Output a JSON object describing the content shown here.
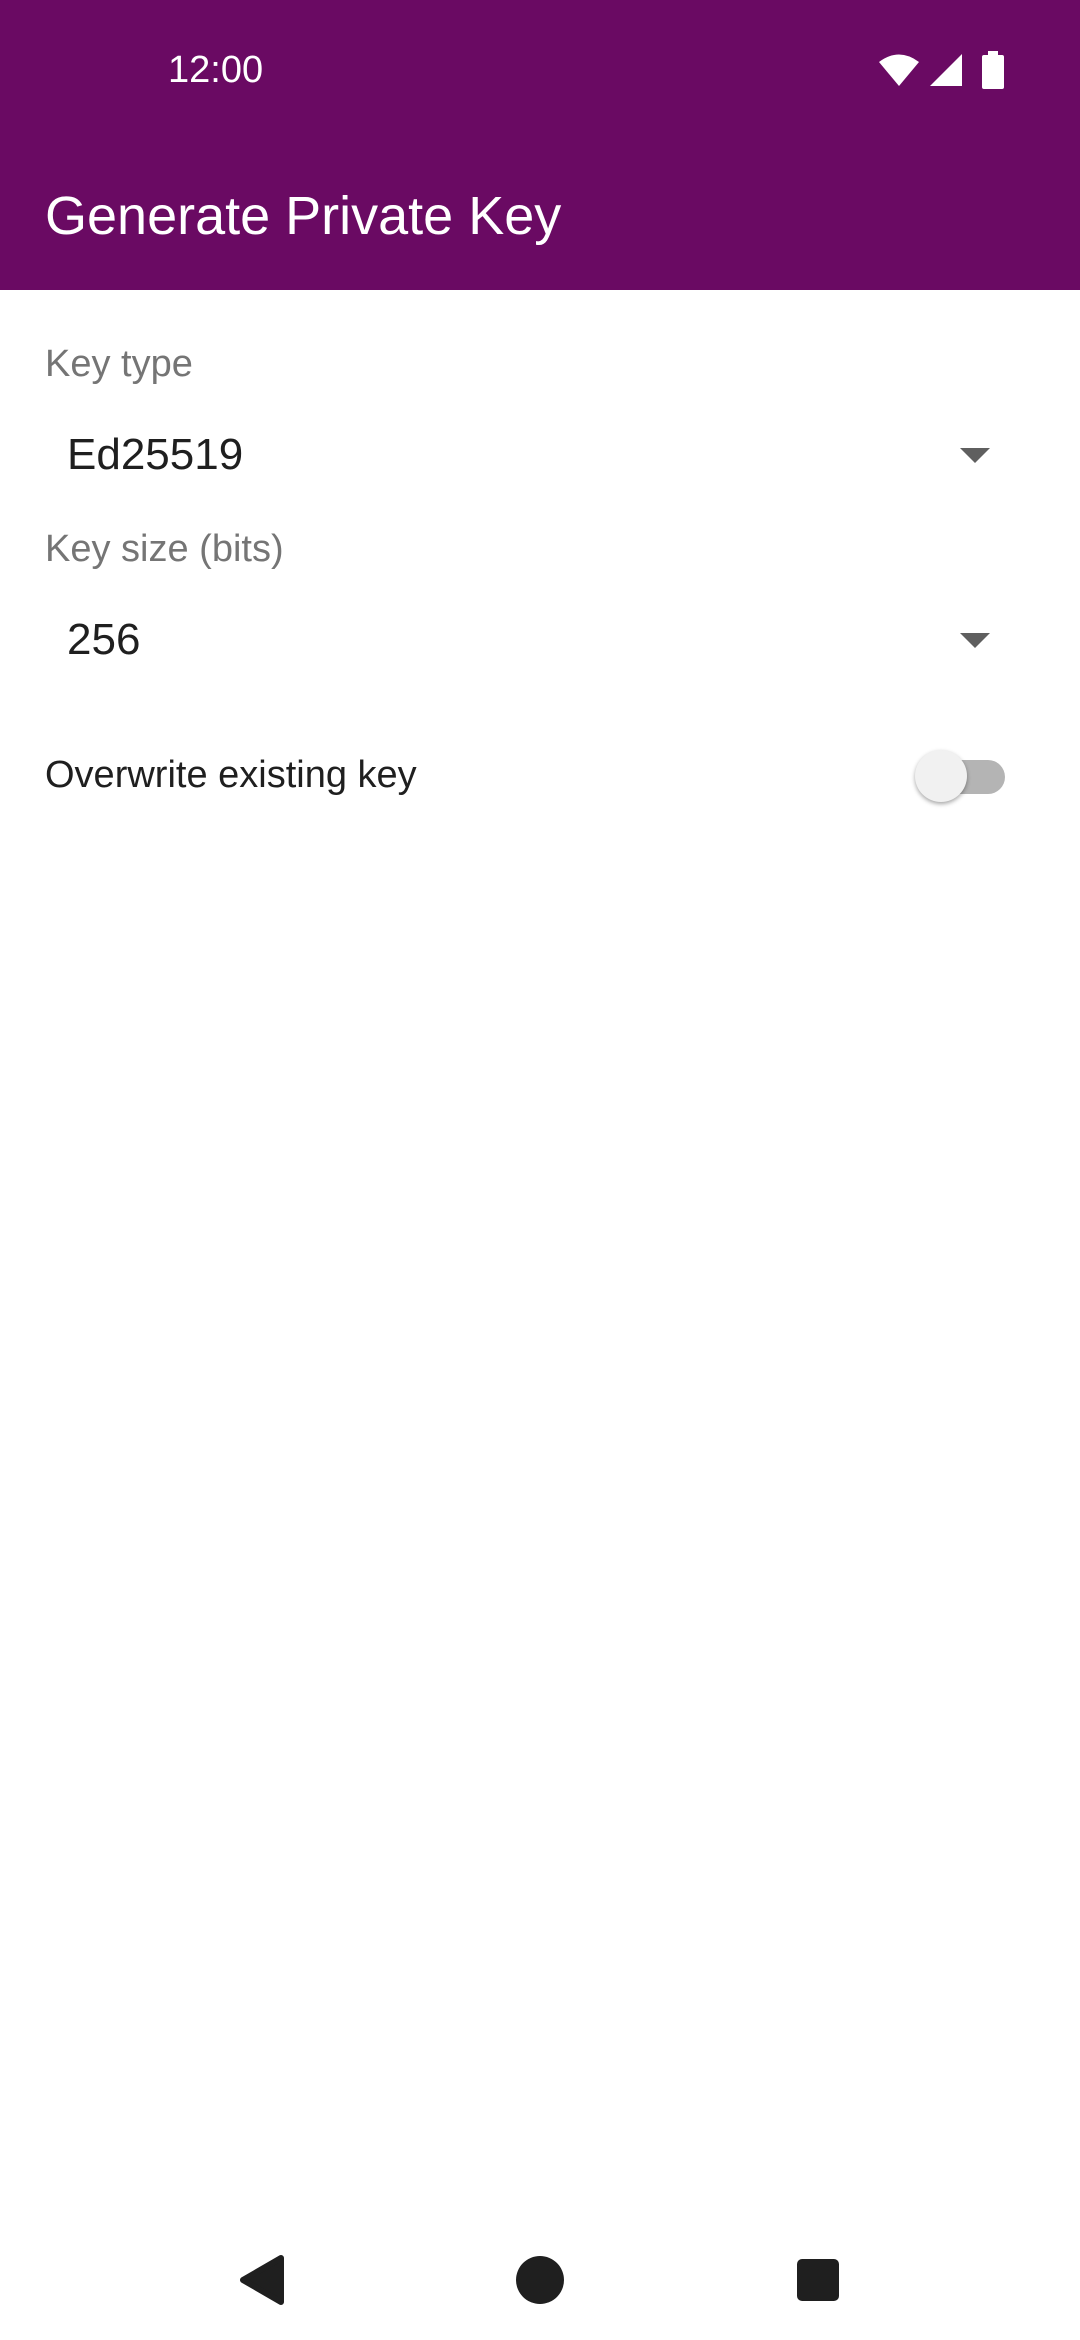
{
  "status_bar": {
    "time": "12:00",
    "icons": [
      "wifi-icon",
      "cell-signal-icon",
      "battery-icon"
    ]
  },
  "app_bar": {
    "title": "Generate Private Key",
    "color": "#6a0a63"
  },
  "form": {
    "key_type": {
      "label": "Key type",
      "selected": "Ed25519"
    },
    "key_size": {
      "label": "Key size (bits)",
      "selected": "256"
    },
    "overwrite": {
      "label": "Overwrite existing key",
      "checked": false
    }
  },
  "nav_bar": {
    "icons": [
      "back-icon",
      "home-icon",
      "recents-icon"
    ]
  }
}
